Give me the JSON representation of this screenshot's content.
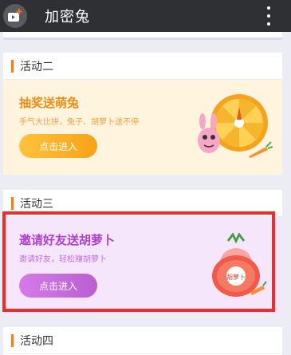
{
  "app": {
    "title": "加密兔",
    "icon": "rabbit-camera-icon"
  },
  "sections": [
    {
      "label": "活动二",
      "card": {
        "title": "抽奖送萌兔",
        "desc": "手气大比拼，兔子、胡萝卜送不停",
        "button": "点击进入",
        "art": "lucky-wheel-bunny"
      }
    },
    {
      "label": "活动三",
      "card": {
        "title": "邀请好友送胡萝卜",
        "desc": "邀请好友，轻松赚胡萝卜",
        "button": "点击进入",
        "art": "carrot-bag",
        "bag_label": "胡萝卜"
      }
    },
    {
      "label": "活动四"
    }
  ],
  "colors": {
    "accent_bar": "#f07d2a",
    "orange_title": "#f08b12",
    "purple_title": "#b23ecf",
    "highlight": "#ef2b2b"
  }
}
